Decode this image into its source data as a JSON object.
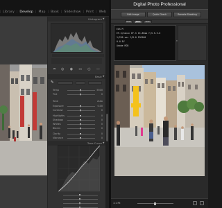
{
  "lightroom": {
    "modules": [
      "Library",
      "Develop",
      "Map",
      "Book",
      "Slideshow",
      "Print",
      "Web"
    ],
    "active_module": "Develop",
    "panel_headers": {
      "histogram": "Histogram",
      "basic": "Basic",
      "tone_curve": "Tone Curve"
    },
    "tool_icons": [
      "crop-icon",
      "spot-removal-icon",
      "red-eye-icon",
      "graduated-filter-icon",
      "radial-filter-icon",
      "adjustment-brush-icon"
    ],
    "basic_rows": [
      {
        "label": "Treatment",
        "value": ""
      },
      {
        "label": "WB",
        "value": ""
      },
      {
        "label": "Temp",
        "value": "5500"
      },
      {
        "label": "Tint",
        "value": "0"
      },
      {
        "label": "Tone",
        "value": "Auto"
      },
      {
        "label": "Exposure",
        "value": "0.00"
      },
      {
        "label": "Contrast",
        "value": "0"
      },
      {
        "label": "Highlights",
        "value": "0"
      },
      {
        "label": "Shadows",
        "value": "0"
      },
      {
        "label": "Whites",
        "value": "0"
      },
      {
        "label": "Blacks",
        "value": "0"
      },
      {
        "label": "Presence",
        "value": ""
      },
      {
        "label": "Clarity",
        "value": "0"
      },
      {
        "label": "Vibrance",
        "value": "0"
      },
      {
        "label": "Saturation",
        "value": "0"
      }
    ],
    "slider_levels": [
      0.5,
      0.5,
      0.5,
      0.5,
      0.5,
      0.5,
      0.5,
      0.5,
      0.5,
      0.5,
      0.5,
      0.5
    ]
  },
  "dpp": {
    "title": "Digital Photo Professional",
    "toolbar": [
      "Edit Image",
      "Quick Check",
      "Remote Shooting"
    ],
    "subtabs": [
      "RAW",
      "JPEG",
      "Both"
    ],
    "side_label": "File name",
    "info_lines": [
      "EOS M",
      "EF-S/Canon EF-S 15-85mm f/3.5-5.6",
      "1/250 sec f/8.0 ISO100",
      "0.0 EV",
      "Adobe RGB"
    ],
    "status_zoom": "1:1 Fit"
  }
}
